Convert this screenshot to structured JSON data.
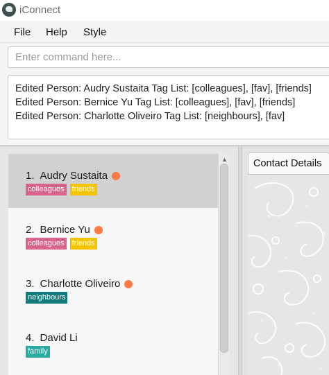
{
  "app": {
    "title": "iConnect"
  },
  "menu": {
    "items": [
      "File",
      "Help",
      "Style"
    ]
  },
  "command": {
    "placeholder": "Enter command here...",
    "value": ""
  },
  "result": {
    "lines": [
      "Edited Person: Audry Sustaita Tag List: [colleagues], [fav], [friends]",
      "Edited Person: Bernice Yu Tag List: [colleagues], [fav], [friends]",
      "Edited Person: Charlotte Oliveiro Tag List: [neighbours], [fav]"
    ]
  },
  "persons": [
    {
      "index": "1.",
      "name": "Audry Sustaita",
      "fav": true,
      "selected": true,
      "tags": [
        {
          "label": "colleagues",
          "color": "#d8648a"
        },
        {
          "label": "friends",
          "color": "#f5c400"
        }
      ]
    },
    {
      "index": "2.",
      "name": "Bernice Yu",
      "fav": true,
      "selected": false,
      "tags": [
        {
          "label": "colleagues",
          "color": "#d8648a"
        },
        {
          "label": "friends",
          "color": "#f5c400"
        }
      ]
    },
    {
      "index": "3.",
      "name": "Charlotte Oliveiro",
      "fav": true,
      "selected": false,
      "tags": [
        {
          "label": "neighbours",
          "color": "#127a78"
        }
      ]
    },
    {
      "index": "4.",
      "name": "David Li",
      "fav": false,
      "selected": false,
      "tags": [
        {
          "label": "family",
          "color": "#2aaaa0"
        }
      ]
    }
  ],
  "colors": {
    "fav_dot": "#ff7a45",
    "selected_row": "#d1d1d1"
  },
  "details": {
    "tab_label": "Contact Details"
  }
}
